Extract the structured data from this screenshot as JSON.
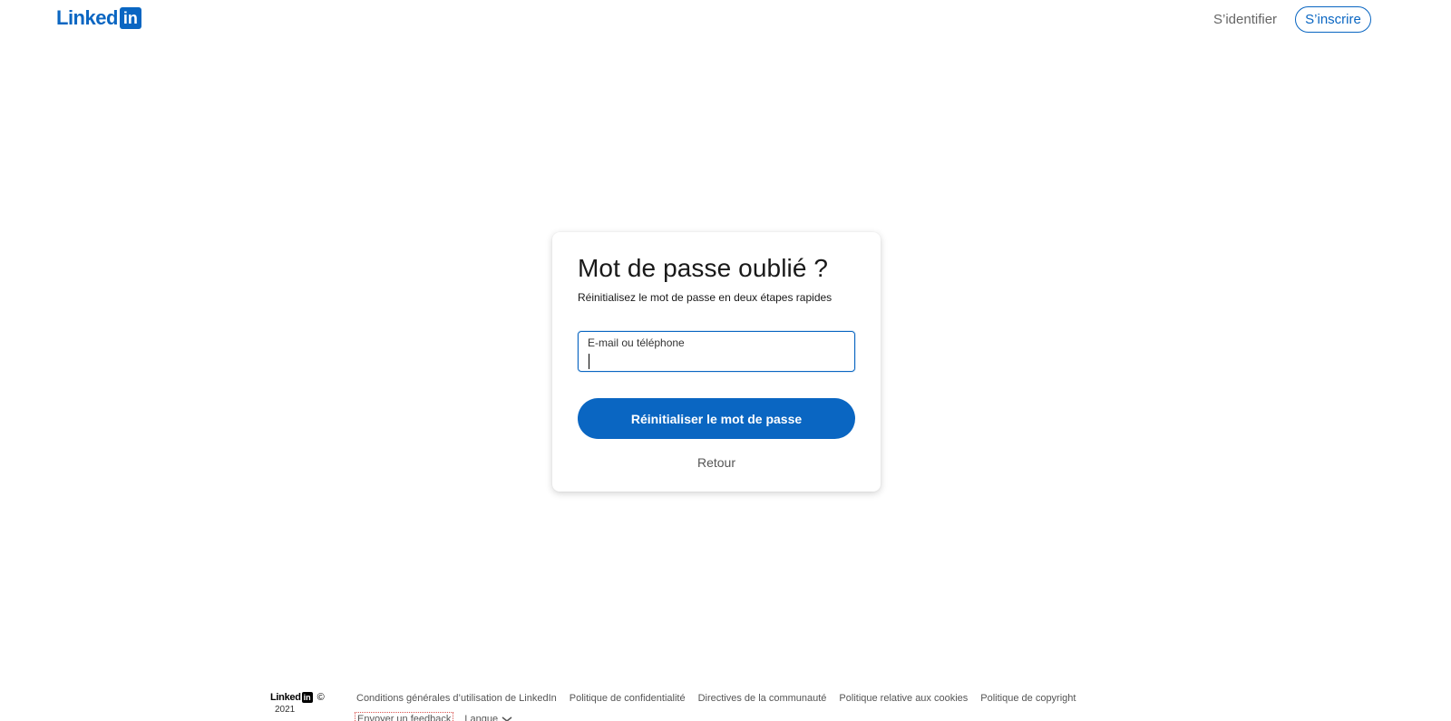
{
  "header": {
    "logo_text": "Linked",
    "logo_in": "in",
    "signin_label": "S’identifier",
    "join_label": "S’inscrire"
  },
  "card": {
    "title": "Mot de passe oublié ?",
    "subtitle": "Réinitialisez le mot de passe en deux étapes rapides",
    "input_label": "E-mail ou téléphone",
    "input_value": "",
    "submit_label": "Réinitialiser le mot de passe",
    "back_label": "Retour"
  },
  "footer": {
    "logo_text": "Linked",
    "logo_in": "in",
    "copyright": "©",
    "year": "2021",
    "links": [
      "Conditions générales d’utilisation de LinkedIn",
      "Politique de confidentialité",
      "Directives de la communauté",
      "Politique relative aux cookies",
      "Politique de copyright"
    ],
    "feedback_label": "Envoyer un feedback",
    "language_label": "Langue"
  },
  "colors": {
    "brand": "#0a66c2",
    "text_muted": "#666666"
  }
}
